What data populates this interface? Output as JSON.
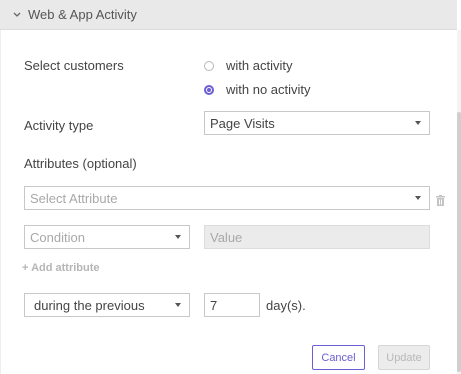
{
  "section": {
    "title": "Web & App Activity"
  },
  "select_customers": {
    "label": "Select customers",
    "options": [
      {
        "label": "with activity",
        "checked": false
      },
      {
        "label": "with no activity",
        "checked": true
      }
    ]
  },
  "activity_type": {
    "label": "Activity type",
    "value": "Page Visits"
  },
  "attributes": {
    "label": "Attributes (optional)",
    "attribute_placeholder": "Select Attribute",
    "condition_placeholder": "Condition",
    "value_placeholder": "Value",
    "add_label": "+ Add attribute"
  },
  "timeframe": {
    "mode": "during the previous",
    "amount": "7",
    "unit": "day(s)."
  },
  "actions": {
    "cancel": "Cancel",
    "update": "Update"
  },
  "colors": {
    "accent": "#6b5fd3",
    "header_bg": "#e9e9e9",
    "disabled_bg": "#ebebeb"
  },
  "icons": {
    "header": "chevron-down-icon",
    "dropdown": "caret-down-icon",
    "remove": "trash-icon"
  }
}
